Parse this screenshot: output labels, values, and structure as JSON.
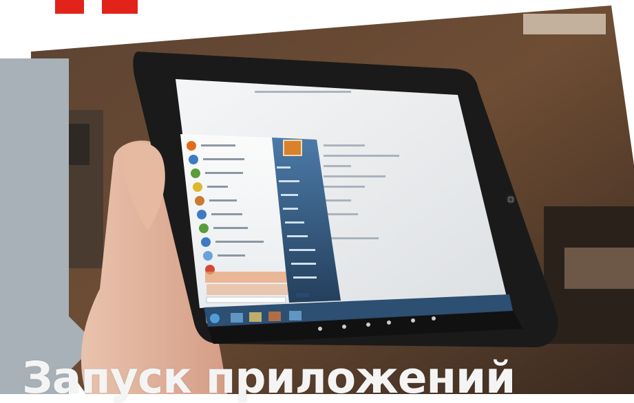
{
  "headline": "Запуск приложений",
  "palette": {
    "brand_red": "#e2231a",
    "side_panel": "#a9b1b8",
    "tablet_bezel": "#1a1a1a",
    "screen": "#f1f3f5",
    "start_menu_right": "#3f6f9e",
    "taskbar": "#2c4f72"
  },
  "tablet": {
    "start_menu": {
      "user_picture": "flower-avatar-icon",
      "programs": [
        "firefox-icon",
        "paint-icon",
        "media-player-icon",
        "folder-icon",
        "notepad-icon",
        "calculator-icon",
        "snipping-tool-icon",
        "help-icon",
        "remote-desktop-icon",
        "browser-icon",
        "acrobat-icon"
      ]
    },
    "taskbar_icons": [
      "start-orb-icon",
      "ie-icon",
      "explorer-icon",
      "media-icon",
      "firefox-icon"
    ]
  }
}
